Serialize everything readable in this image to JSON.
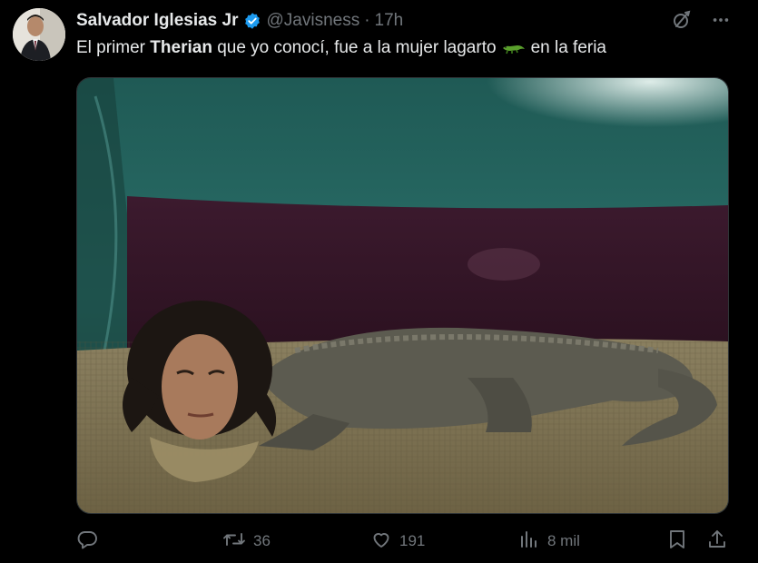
{
  "tweet": {
    "author": {
      "display_name": "Salvador Iglesias Jr",
      "handle": "@Javisness",
      "separator": "·",
      "time": "17h",
      "verified": true
    },
    "text": {
      "part1": "El primer ",
      "bold": "Therian",
      "part2": " que yo conocí, fue a la mujer lagarto",
      "emoji": "crocodile-emoji",
      "part3": "en la feria"
    },
    "media": {
      "type": "photo"
    },
    "actions": {
      "reply": {
        "icon": "reply-icon",
        "count": ""
      },
      "retweet": {
        "icon": "retweet-icon",
        "count": "36"
      },
      "like": {
        "icon": "heart-icon",
        "count": "191"
      },
      "views": {
        "icon": "views-icon",
        "count": "8 mil"
      },
      "bookmark": {
        "icon": "bookmark-icon"
      },
      "share": {
        "icon": "share-icon"
      }
    },
    "header_icons": [
      "grok-icon",
      "more-icon"
    ]
  },
  "colors": {
    "background": "#000000",
    "text_primary": "#e7e9ea",
    "text_secondary": "#71767b",
    "verified_blue": "#1d9bf0",
    "border": "#2f3336"
  }
}
